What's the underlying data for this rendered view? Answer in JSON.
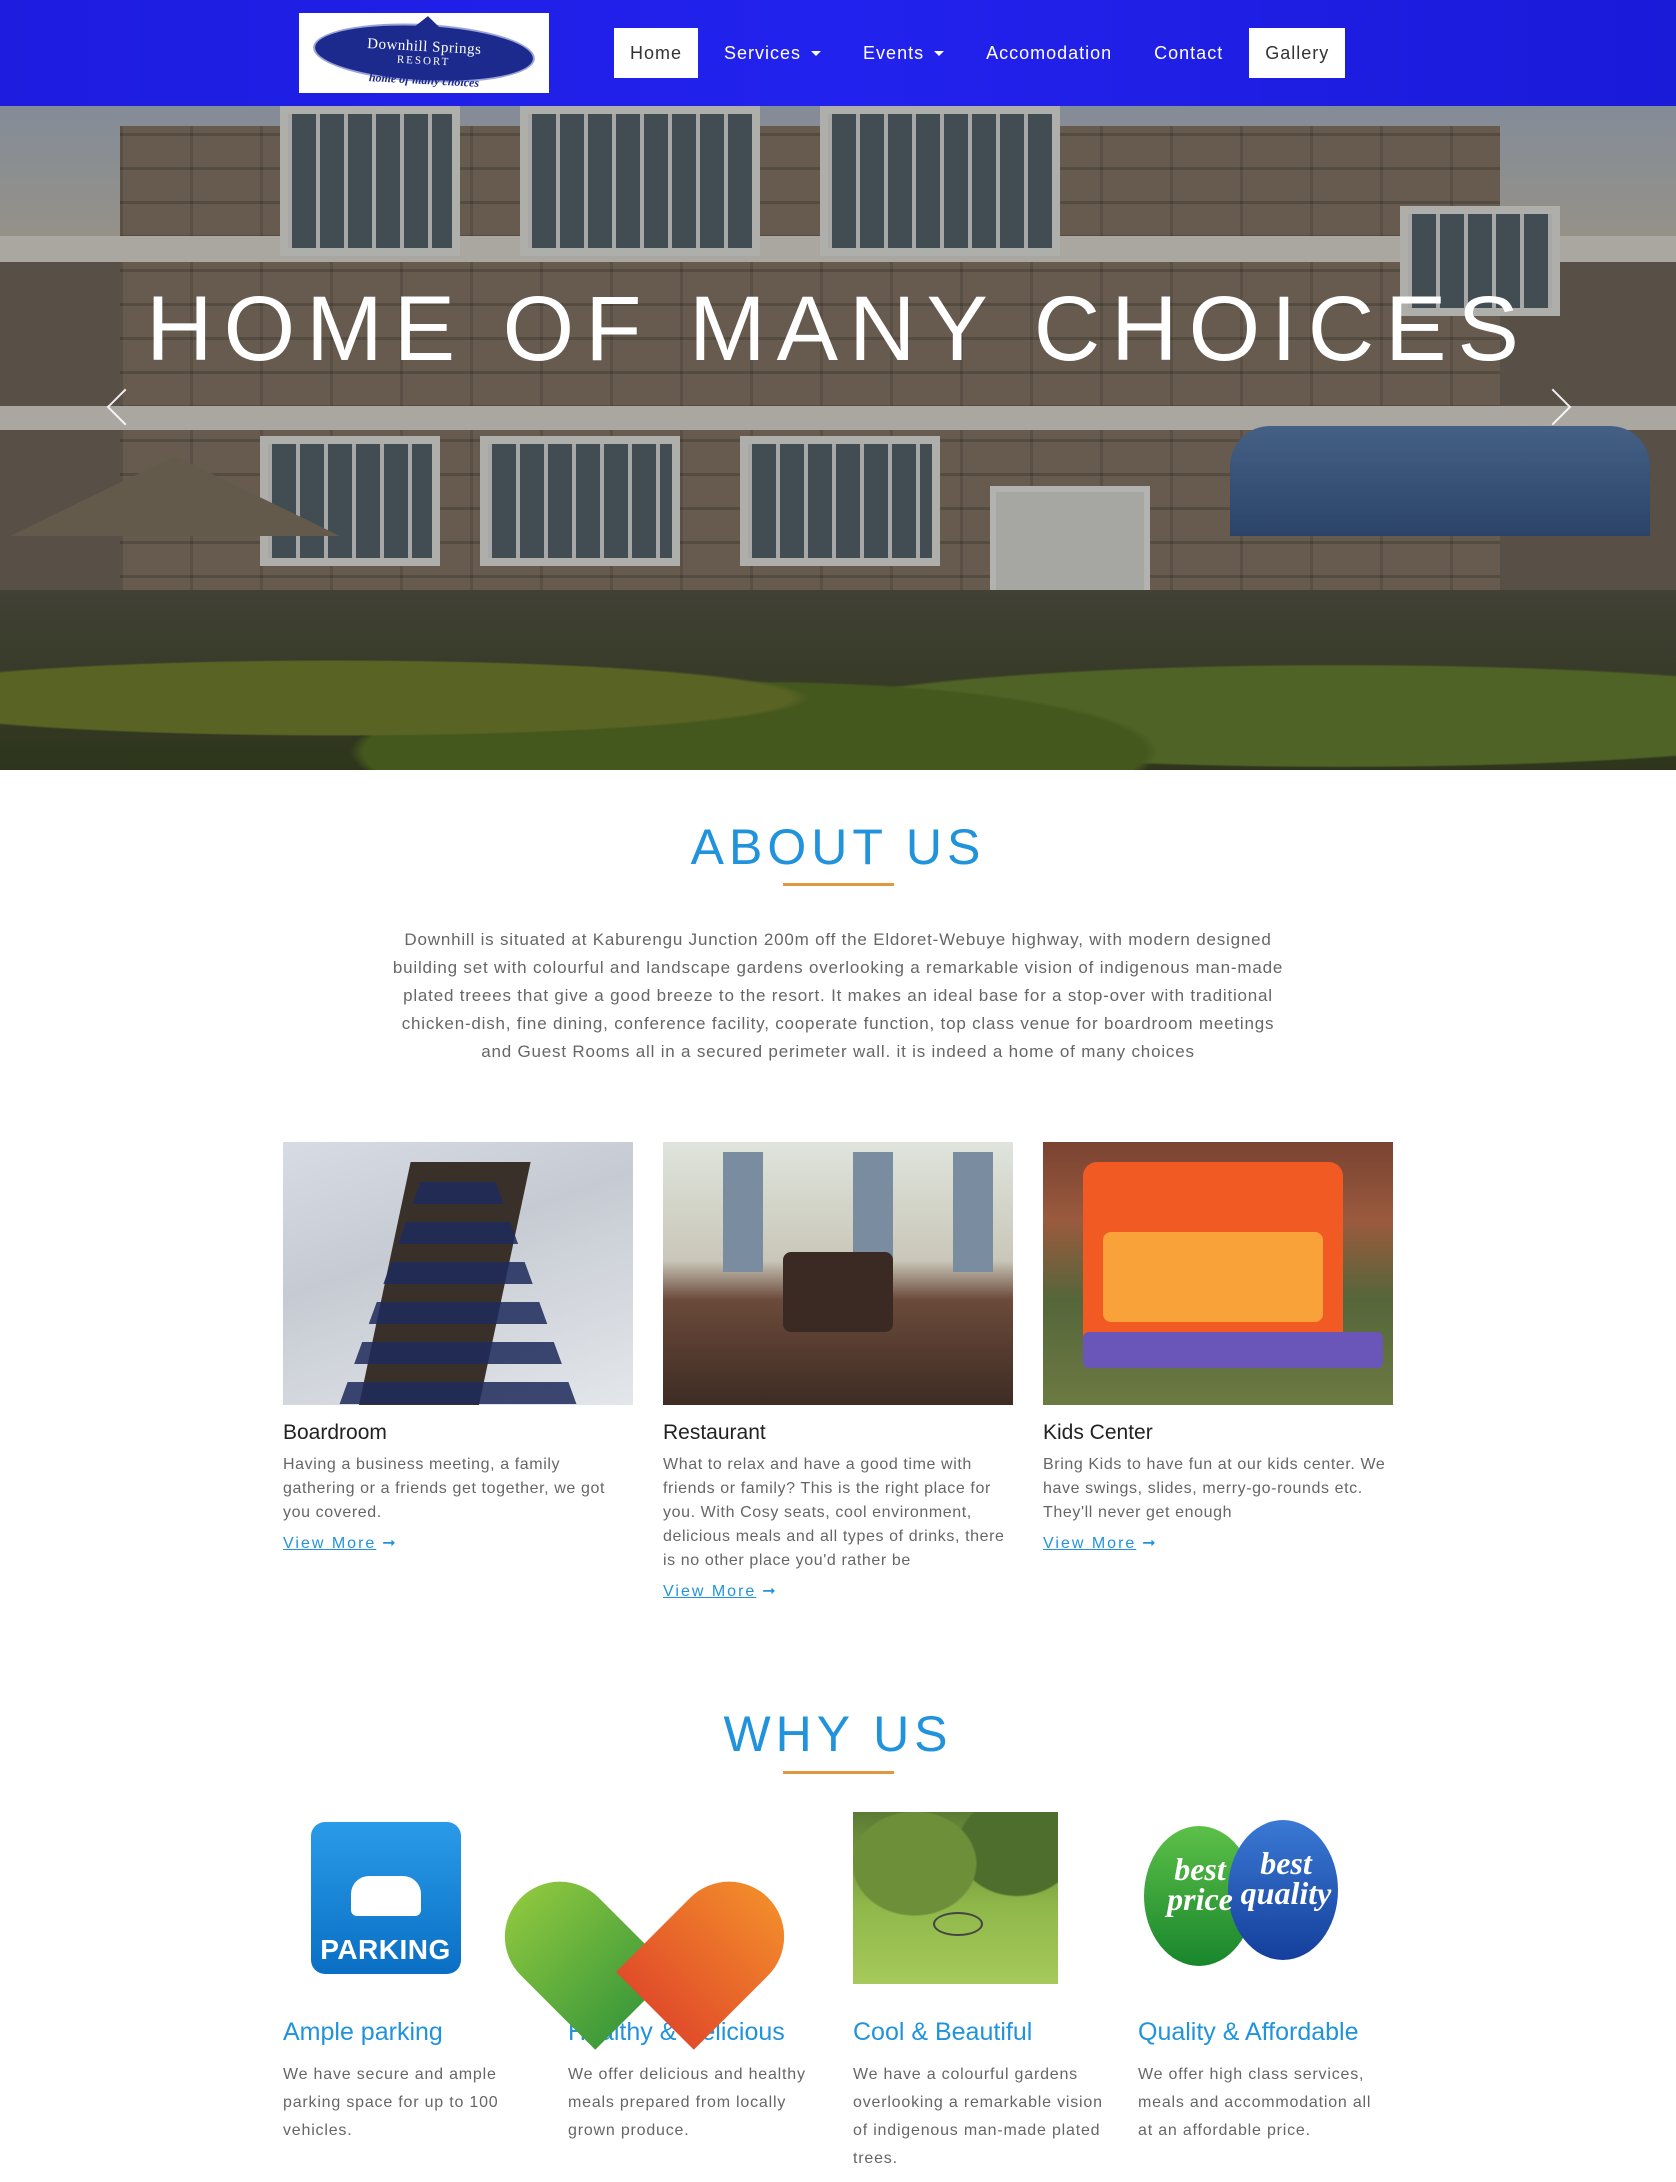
{
  "navbar": {
    "logo": {
      "line1": "Downhill Springs",
      "line2": "RESORT",
      "tagline": "home of many choices"
    },
    "items": [
      {
        "label": "Home",
        "active": true
      },
      {
        "label": "Services",
        "dropdown": true
      },
      {
        "label": "Events",
        "dropdown": true
      },
      {
        "label": "Accomodation"
      },
      {
        "label": "Contact"
      },
      {
        "label": "Gallery",
        "active": true
      }
    ]
  },
  "hero": {
    "title": "HOME OF MANY CHOICES",
    "prev_icon": "chevron-left-icon",
    "next_icon": "chevron-right-icon"
  },
  "about": {
    "title": "ABOUT US",
    "text": "Downhill is situated at Kaburengu Junction 200m off the Eldoret-Webuye highway, with modern designed building set with colourful and landscape gardens overlooking a remarkable vision of indigenous man-made plated treees that give a good breeze to the resort. It makes an ideal base for a stop-over with traditional chicken-dish, fine dining, conference facility, cooperate function, top class venue for boardroom meetings and Guest Rooms all in a secured perimeter wall. it is indeed a home of many choices"
  },
  "services": [
    {
      "title": "Boardroom",
      "text": "Having a business meeting, a family gathering or a friends get together, we got you covered.",
      "link": "View More"
    },
    {
      "title": "Restaurant",
      "text": "What to relax and have a good time with friends or family? This is the right place for you. With Cosy seats, cool environment, delicious meals and all types of drinks, there is no other place you'd rather be",
      "link": "View More"
    },
    {
      "title": "Kids Center",
      "text": "Bring Kids to have fun at our kids center. We have swings, slides, merry-go-rounds etc. They'll never get enough",
      "link": "View More"
    }
  ],
  "why": {
    "title": "WHY US",
    "items": [
      {
        "title": "Ample parking",
        "text": "We have secure and ample parking space for up to 100 vehicles.",
        "image_label": "PARKING"
      },
      {
        "title": "Healthy & Delicious",
        "text": "We offer delicious and healthy meals prepared from locally grown produce."
      },
      {
        "title": "Cool & Beautiful",
        "text": "We have a colourful gardens overlooking a remarkable vision of indigenous man-made plated trees."
      },
      {
        "title": "Quality & Affordable",
        "text": "We offer high class services, meals and accommodation all at an affordable price.",
        "image_label_1": "best price",
        "image_label_2": "best quality"
      }
    ]
  },
  "colors": {
    "navbar": "#1d1cdf",
    "accent": "#2193dc",
    "rule": "#e0973d"
  }
}
